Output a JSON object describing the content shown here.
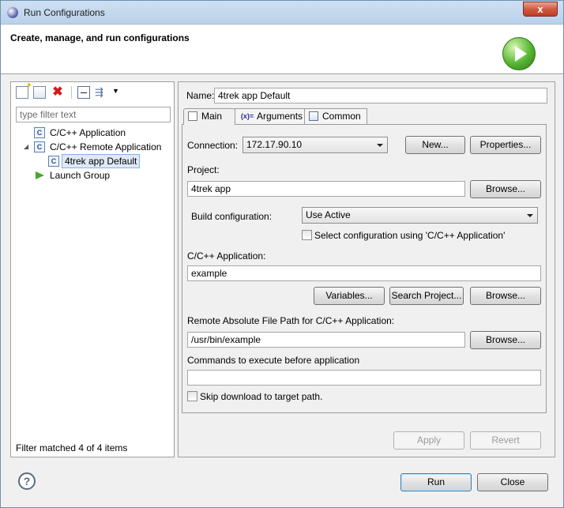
{
  "window": {
    "title": "Run Configurations",
    "close_glyph": "x"
  },
  "header": {
    "heading": "Create, manage, and run configurations",
    "icon": "run-icon"
  },
  "left": {
    "toolbar_icons": [
      "new-configuration-icon",
      "duplicate-icon",
      "delete-icon",
      "collapse-all-icon",
      "filter-icon"
    ],
    "filter_placeholder": "type filter text",
    "tree": [
      {
        "label": "C/C++ Application",
        "icon": "c-config-icon"
      },
      {
        "label": "C/C++ Remote Application",
        "icon": "c-config-icon",
        "expanded": true
      },
      {
        "label": "4trek app Default",
        "icon": "c-config-icon",
        "selected": true
      },
      {
        "label": "Launch Group",
        "icon": "launch-group-icon"
      }
    ],
    "status": "Filter matched 4 of 4 items"
  },
  "right": {
    "name_label": "Name:",
    "name_value": "4trek app Default",
    "tabs": [
      {
        "label": "Main",
        "active": true
      },
      {
        "label": "Arguments",
        "icon_text": "(x)="
      },
      {
        "label": "Common"
      }
    ],
    "main": {
      "connection_label": "Connection:",
      "connection_value": "172.17.90.10",
      "new_button": "New...",
      "properties_button": "Properties...",
      "project_label": "Project:",
      "project_value": "4trek app",
      "project_browse": "Browse...",
      "build_config_label": "Build configuration:",
      "build_config_value": "Use Active",
      "select_config_label": "Select configuration using 'C/C++ Application'",
      "app_label": "C/C++ Application:",
      "app_value": "example",
      "variables_button": "Variables...",
      "search_project_button": "Search Project...",
      "app_browse": "Browse...",
      "remote_path_label": "Remote Absolute File Path for C/C++ Application:",
      "remote_path_value": "/usr/bin/example",
      "remote_browse": "Browse...",
      "commands_label": "Commands to execute before application",
      "commands_value": "",
      "skip_download_label": "Skip download to target path."
    },
    "apply_button": "Apply",
    "revert_button": "Revert"
  },
  "footer": {
    "help_glyph": "?",
    "run_button": "Run",
    "close_button": "Close"
  }
}
